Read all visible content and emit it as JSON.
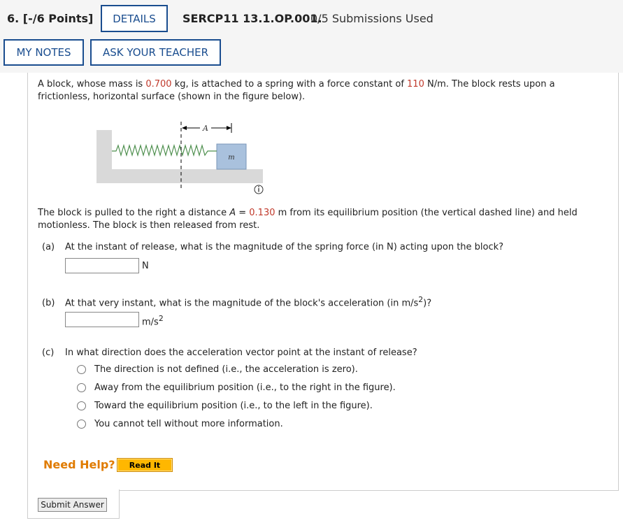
{
  "header": {
    "question_number": "6. [-/6 Points]",
    "details_label": "DETAILS",
    "question_code": "SERCP11 13.1.OP.001.",
    "submissions": "0/5 Submissions Used",
    "my_notes_label": "MY NOTES",
    "ask_teacher_label": "ASK YOUR TEACHER"
  },
  "problem": {
    "intro_a": "A block, whose mass is ",
    "mass": "0.700",
    "intro_b": " kg, is attached to a spring with a force constant of ",
    "k": "110",
    "intro_c": " N/m. The block rests upon a frictionless, horizontal surface (shown in the figure below).",
    "figure": {
      "a_label": "A",
      "m_label": "m",
      "info_icon": "info-icon"
    },
    "pulled_a": "The block is pulled to the right a distance ",
    "A_symbol": "A",
    "pulled_eq": " = ",
    "distance": "0.130",
    "pulled_b": " m from its equilibrium position (the vertical dashed line) and held motionless. The block is then released from rest."
  },
  "parts": {
    "a": {
      "tag": "(a)",
      "question": "At the instant of release, what is the magnitude of the spring force (in N) acting upon the block?",
      "value": "",
      "unit": "N"
    },
    "b": {
      "tag": "(b)",
      "question_pre": "At that very instant, what is the magnitude of the block's acceleration (in m/s",
      "question_sup": "2",
      "question_post": ")?",
      "value": "",
      "unit_base": "m/s",
      "unit_sup": "2"
    },
    "c": {
      "tag": "(c)",
      "question": "In what direction does the acceleration vector point at the instant of release?",
      "options": [
        "The direction is not defined (i.e., the acceleration is zero).",
        "Away from the equilibrium position (i.e., to the right in the figure).",
        "Toward the equilibrium position (i.e., to the left in the figure).",
        "You cannot tell without more information."
      ]
    }
  },
  "help": {
    "need_help": "Need Help?",
    "read_it": "Read It"
  },
  "submit_label": "Submit Answer",
  "colors": {
    "accent_blue": "#1a4d8f",
    "value_red": "#c0392b",
    "help_orange": "#e07b00",
    "read_it_bg": "#ffb700"
  }
}
